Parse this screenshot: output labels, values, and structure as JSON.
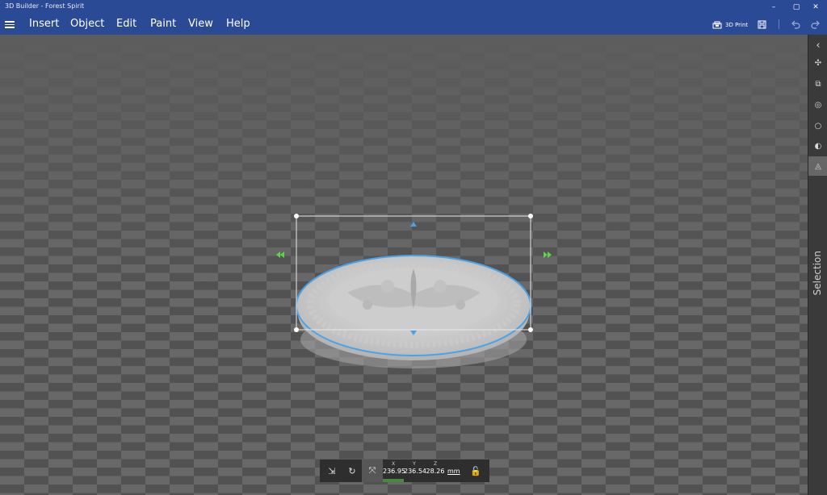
{
  "app": {
    "title": "3D Builder - Forest Spirit"
  },
  "window_controls": {
    "minimize": "–",
    "maximize": "▢",
    "close": "✕"
  },
  "menu": {
    "items": [
      "Insert",
      "Object",
      "Edit",
      "Paint",
      "View",
      "Help"
    ],
    "print_label": "3D Print"
  },
  "toolbar_icons": [
    "print-icon",
    "save-icon",
    "undo-icon",
    "redo-icon"
  ],
  "rail": {
    "collapse_glyph": "‹",
    "icons": [
      "lasso-icon",
      "select-object-icon",
      "select-face-icon",
      "select-circle-icon",
      "select-region-icon",
      "select-triangle-icon"
    ],
    "glyphs": [
      "✣",
      "⧉",
      "◎",
      "○",
      "◐",
      "◬"
    ],
    "active_index": 5,
    "label": "Selection"
  },
  "dimensions": {
    "x_label": "X",
    "x_value": "236.95",
    "y_label": "Y",
    "y_value": "236.54",
    "z_label": "Z",
    "z_value": "28.26",
    "unit": "mm"
  },
  "bottom_icons": {
    "move": "⇲",
    "rotate": "↻",
    "scale": "⤧",
    "lock": "🔓"
  },
  "colors": {
    "chrome": "#2b4a96",
    "floor_light": "#6b6b6b",
    "floor_dark": "#4d4d4d",
    "selection_outline": "#4aa3e8",
    "move_arrow": "#5fd44a",
    "model": "#d6d6d6"
  }
}
